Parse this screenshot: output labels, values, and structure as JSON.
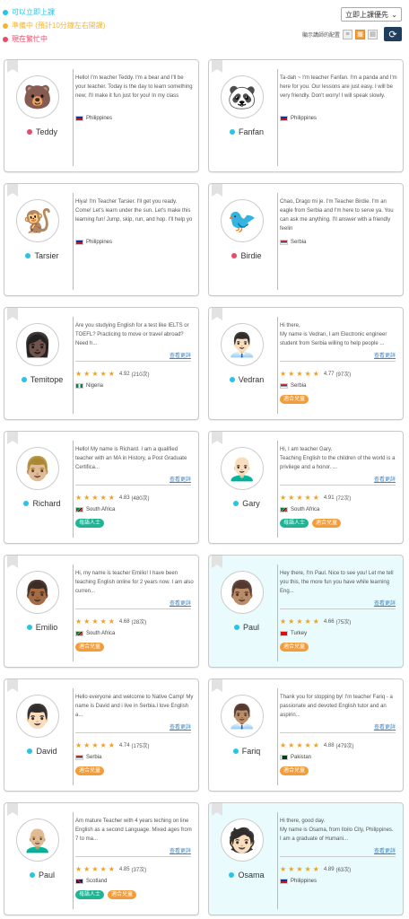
{
  "legend": [
    {
      "label": "可以立即上課",
      "color": "#27c4e6"
    },
    {
      "label": "準備中 (預計10分鐘左右開課)",
      "color": "#f2b633"
    },
    {
      "label": "現在繁忙中",
      "color": "#e84a6a"
    }
  ],
  "sort": {
    "label": "立即上課優先"
  },
  "layout_label": "顯示講師的配置",
  "colors": {
    "available": "#27c4e6",
    "busy": "#e84a6a",
    "native": "#20b394",
    "kids": "#f39c3a",
    "star": "#f3a01b"
  },
  "view_profile": "查看更詳",
  "teachers": [
    {
      "name": "Teddy",
      "status": "busy",
      "avatar": "🐻",
      "bio": "Hello! I'm teacher Teddy. I'm a bear and I'll be your teacher. Today is the day to learn something new; I'll make it fun just for you! In my class",
      "country": "Philippines",
      "flag": "ph",
      "show_rating": false
    },
    {
      "name": "Fanfan",
      "status": "available",
      "avatar": "🐼",
      "bio": "Ta-dah ~ I'm teacher Fanfan. I'm a panda and I'm here for you. Our lessons are just easy. I will be very friendly. Don't worry! I will speak slowly.",
      "country": "Philippines",
      "flag": "ph",
      "show_rating": false
    },
    {
      "name": "Tarsier",
      "status": "available",
      "avatar": "🐒",
      "bio": "Hiya! I'm Teacher Tarsier. I'll get you ready. Come! Let's learn under the sun. Let's make this learning fun! Jump, skip, run, and hop. I'll help yo",
      "country": "Philippines",
      "flag": "ph",
      "show_rating": false
    },
    {
      "name": "Birdie",
      "status": "busy",
      "avatar": "🐦",
      "bio": "Chao, Drago mi je. I'm Teacher Birdie. I'm an eagle from Serbia and I'm here to serve ya. You can ask me anything. I'll answer with a friendly feelin",
      "country": "Serbia",
      "flag": "rs",
      "show_rating": false
    },
    {
      "name": "Temitope",
      "status": "available",
      "avatar": "👩🏿",
      "bio": "Are you studying English for a test like IELTS or TOEFL? Practicing to move or travel abroad? Need h...",
      "rating": "4.92",
      "reviews": "(210次)",
      "country": "Nigeria",
      "flag": "ng",
      "show_rating": true,
      "tags": []
    },
    {
      "name": "Vedran",
      "status": "available",
      "avatar": "👨🏻‍💼",
      "bio": "Hi there,\nMy name is Vedran, I am Electronic engineer student from Serbia willing to help people ...",
      "rating": "4.77",
      "reviews": "(97次)",
      "country": "Serbia",
      "flag": "rs",
      "show_rating": true,
      "tags": [
        "kids"
      ]
    },
    {
      "name": "Richard",
      "status": "available",
      "avatar": "👨🏼",
      "bio": "Hello! My name is Richard. I am a qualified teacher with an MA in History, a Post Graduate Certifica...",
      "rating": "4.83",
      "reviews": "(480次)",
      "country": "South Africa",
      "flag": "za",
      "show_rating": true,
      "tags": [
        "native"
      ]
    },
    {
      "name": "Gary",
      "status": "available",
      "avatar": "👨🏻‍🦲",
      "bio": "Hi, I am teacher Gary.\nTeaching English to the children of the world is a privilege and a honor. ...",
      "rating": "4.91",
      "reviews": "(72次)",
      "country": "South Africa",
      "flag": "za",
      "show_rating": true,
      "tags": [
        "native",
        "kids"
      ]
    },
    {
      "name": "Emilio",
      "status": "available",
      "avatar": "👨🏾",
      "bio": "Hi, my name is teacher Emilio! I have been teaching English online for 2 years now. I am also curren...",
      "rating": "4.68",
      "reviews": "(28次)",
      "country": "South Africa",
      "flag": "za",
      "show_rating": true,
      "tags": [
        "kids"
      ]
    },
    {
      "name": "Paul",
      "status": "available",
      "avatar": "👨🏽",
      "bio": "Hey there, I'm Paul. Nice to see you! Let me tell you this, the more fun you have while learning Eng...",
      "rating": "4.66",
      "reviews": "(75次)",
      "country": "Turkey",
      "flag": "tr",
      "show_rating": true,
      "tags": [
        "kids"
      ],
      "highlight": true
    },
    {
      "name": "David",
      "status": "available",
      "avatar": "👨🏻",
      "bio": "Hello everyone and welcome to Native Camp! My name is David and i live in Serbia.I love English a...",
      "rating": "4.74",
      "reviews": "(175次)",
      "country": "Serbia",
      "flag": "rs",
      "show_rating": true,
      "tags": [
        "kids"
      ]
    },
    {
      "name": "Fariq",
      "status": "available",
      "avatar": "👨🏽‍💼",
      "bio": "Thank you for stopping by! I'm teacher Fariq - a passionate and devoted English tutor and an aspirin...",
      "rating": "4.88",
      "reviews": "(479次)",
      "country": "Pakistan",
      "flag": "pk",
      "show_rating": true,
      "tags": [
        "kids"
      ]
    },
    {
      "name": "Paul",
      "status": "available",
      "avatar": "👨🏼‍🦲",
      "bio": "Am mature Teacher with 4 years teching on line English as a second Language. Mixed ages from 7 to ma...",
      "rating": "4.85",
      "reviews": "(37次)",
      "country": "Scotland",
      "flag": "gb",
      "show_rating": true,
      "tags": [
        "native",
        "kids"
      ]
    },
    {
      "name": "Osama",
      "status": "available",
      "avatar": "🧑🏻",
      "bio": "Hi there, good day.\nMy name is Osama, from Iloilo City, Philippines.\nI am a graduate of Humani...",
      "rating": "4.89",
      "reviews": "(63次)",
      "country": "Philippines",
      "flag": "ph",
      "show_rating": true,
      "tags": [],
      "highlight": true
    }
  ],
  "tag_labels": {
    "native": "母語人士",
    "kids": "適合兒童"
  }
}
